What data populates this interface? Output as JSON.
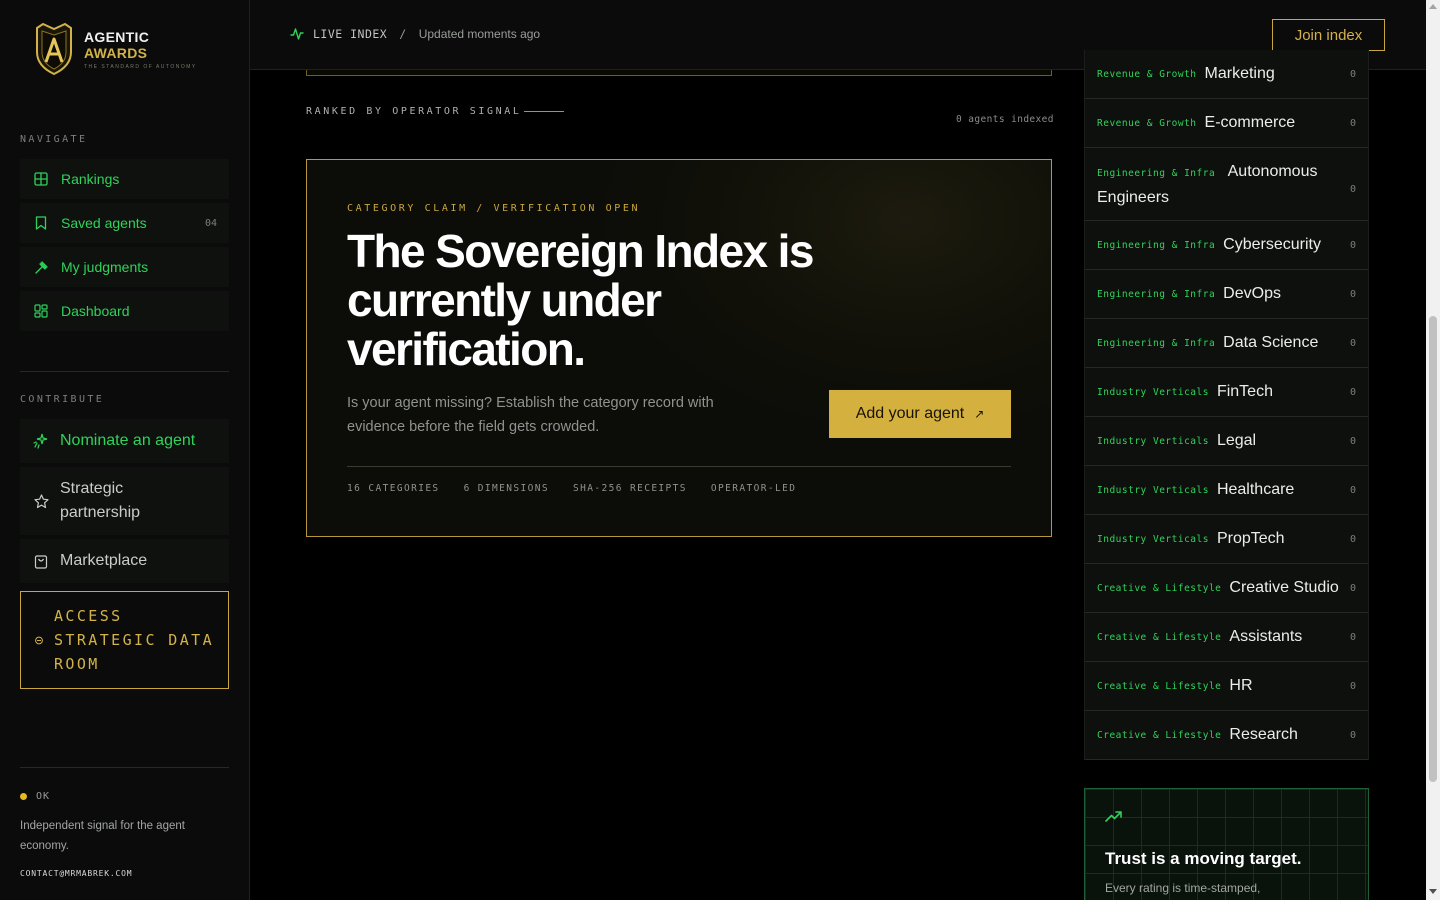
{
  "brand": {
    "line1": "AGENTIC",
    "line2": "AWARDS",
    "tagline": "THE STANDARD OF AUTONOMY",
    "logo_icon": "shield-a-icon"
  },
  "sidebar": {
    "navigate_label": "NAVIGATE",
    "nav": [
      {
        "label": "Rankings",
        "icon": "grid-icon"
      },
      {
        "label": "Saved agents",
        "icon": "bookmark-icon",
        "count": "04"
      },
      {
        "label": "My judgments",
        "icon": "gavel-icon"
      },
      {
        "label": "Dashboard",
        "icon": "dashboard-icon"
      }
    ],
    "contribute_label": "CONTRIBUTE",
    "contribute": [
      {
        "label": "Nominate an agent",
        "icon": "sparkle-icon"
      },
      {
        "label": "Strategic partnership",
        "icon": "star-icon"
      },
      {
        "label": "Marketplace",
        "icon": "shopping-bag-icon"
      }
    ],
    "dataroom_label": "ACCESS STRATEGIC DATA ROOM",
    "status": "OK",
    "description": "Independent signal for the agent economy.",
    "contact": "CONTACT@MRMABREK.COM"
  },
  "topbar": {
    "live_label": "LIVE INDEX",
    "separator": "/",
    "updated": "Updated moments ago",
    "join_label": "Join index"
  },
  "main": {
    "ranked_label": "RANKED BY OPERATOR SIGNAL",
    "indexed": "0 agents indexed",
    "hero": {
      "kicker": "CATEGORY CLAIM / VERIFICATION OPEN",
      "title": "The Sovereign Index is currently under verification.",
      "subtitle": "Is your agent missing? Establish the category record with evidence before the field gets crowded.",
      "button": "Add your agent",
      "tags": [
        "16 CATEGORIES",
        "6 DIMENSIONS",
        "SHA-256 RECEIPTS",
        "OPERATOR-LED"
      ]
    }
  },
  "categories": [
    {
      "group": "Revenue & Growth",
      "name": "Marketing",
      "count": "0"
    },
    {
      "group": "Revenue & Growth",
      "name": "E-commerce",
      "count": "0"
    },
    {
      "group": "Engineering & Infra",
      "name": "Autonomous Engineers",
      "count": "0"
    },
    {
      "group": "Engineering & Infra",
      "name": "Cybersecurity",
      "count": "0"
    },
    {
      "group": "Engineering & Infra",
      "name": "DevOps",
      "count": "0"
    },
    {
      "group": "Engineering & Infra",
      "name": "Data Science",
      "count": "0"
    },
    {
      "group": "Industry Verticals",
      "name": "FinTech",
      "count": "0"
    },
    {
      "group": "Industry Verticals",
      "name": "Legal",
      "count": "0"
    },
    {
      "group": "Industry Verticals",
      "name": "Healthcare",
      "count": "0"
    },
    {
      "group": "Industry Verticals",
      "name": "PropTech",
      "count": "0"
    },
    {
      "group": "Creative & Lifestyle",
      "name": "Creative Studio",
      "count": "0"
    },
    {
      "group": "Creative & Lifestyle",
      "name": "Assistants",
      "count": "0"
    },
    {
      "group": "Creative & Lifestyle",
      "name": "HR",
      "count": "0"
    },
    {
      "group": "Creative & Lifestyle",
      "name": "Research",
      "count": "0"
    }
  ],
  "trust": {
    "icon": "trending-up-icon",
    "title": "Trust is a moving target.",
    "subtitle": "Every rating is time-stamped,"
  },
  "colors": {
    "accent_green": "#2fd35a",
    "accent_gold": "#d4b24a",
    "background": "#000000"
  }
}
